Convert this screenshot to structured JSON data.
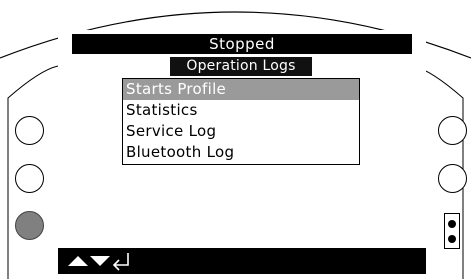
{
  "status": {
    "text": "Stopped"
  },
  "menu": {
    "title": "Operation Logs",
    "items": [
      {
        "label": "Starts Profile",
        "selected": true
      },
      {
        "label": "Statistics",
        "selected": false
      },
      {
        "label": "Service Log",
        "selected": false
      },
      {
        "label": "Bluetooth Log",
        "selected": false
      }
    ]
  },
  "navigation": {
    "icons": [
      "up-arrow-icon",
      "down-arrow-icon",
      "enter-icon"
    ]
  },
  "side_buttons": {
    "left": [
      {
        "name": "left-button-1",
        "state": "outline"
      },
      {
        "name": "left-button-2",
        "state": "outline"
      },
      {
        "name": "left-button-3",
        "state": "filled"
      }
    ],
    "right": [
      {
        "name": "right-button-1",
        "state": "outline"
      },
      {
        "name": "right-button-2",
        "state": "outline"
      }
    ]
  },
  "colors": {
    "background": "#ffffff",
    "bar": "#000000",
    "selection": "#9a9a9a",
    "filled_button": "#808080"
  }
}
